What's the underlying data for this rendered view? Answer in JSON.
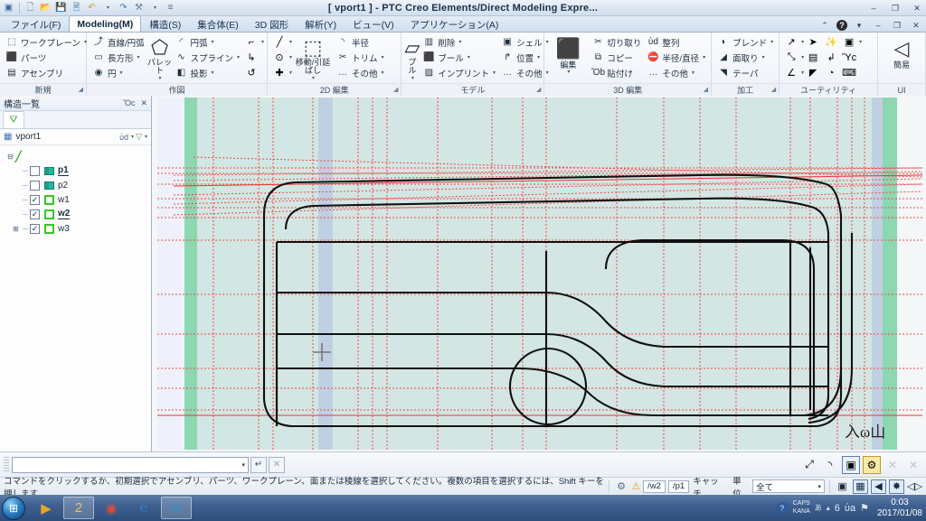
{
  "window": {
    "title": "[ vport1 ] - PTC Creo Elements/Direct Modeling Expre...",
    "minimize": "–",
    "maximize": "❐",
    "close": "✕",
    "inner_minimize": "–",
    "inner_maximize": "❐",
    "inner_close": "✕",
    "help": "?",
    "help_caret": "▾",
    "up_caret": "⌃"
  },
  "quick_access": [
    {
      "name": "app-menu-icon",
      "glyph": "▦"
    },
    {
      "name": "new-icon",
      "glyph": "὜b"
    },
    {
      "name": "open-icon",
      "glyph": "Ὄ2"
    },
    {
      "name": "save-icon",
      "glyph": "Ὃe"
    },
    {
      "name": "print-preview-icon",
      "glyph": "Ὓ6"
    },
    {
      "name": "undo-icon",
      "glyph": "↶"
    },
    {
      "name": "undo-caret",
      "glyph": "▾"
    },
    {
      "name": "redo-icon",
      "glyph": "↷"
    },
    {
      "name": "customize-icon",
      "glyph": "⚒"
    },
    {
      "name": "customize-caret",
      "glyph": "▾"
    },
    {
      "name": "overflow-icon",
      "glyph": "≡"
    }
  ],
  "tabs": [
    {
      "label": "ファイル(F)",
      "active": false
    },
    {
      "label": "Modeling(M)",
      "active": true
    },
    {
      "label": "構造(S)",
      "active": false
    },
    {
      "label": "集合体(E)",
      "active": false
    },
    {
      "label": "3D 図形",
      "active": false
    },
    {
      "label": "解析(Y)",
      "active": false
    },
    {
      "label": "ビュー(V)",
      "active": false
    },
    {
      "label": "アプリケーション(A)",
      "active": false
    }
  ],
  "ribbon": {
    "groups": [
      {
        "label": "新規",
        "launcher": true,
        "items": [
          {
            "icon": "⬚",
            "label": "ワークプレーン",
            "caret": true
          },
          {
            "icon": "⬛",
            "label": "パーツ",
            "caret": false
          },
          {
            "icon": "▤",
            "label": "アセンブリ",
            "caret": false
          }
        ]
      },
      {
        "label": "作図",
        "launcher": false,
        "col1": [
          {
            "icon": "⤴",
            "label": "直線/円弧",
            "caret": false
          },
          {
            "icon": "▭",
            "label": "長方形",
            "caret": true
          },
          {
            "icon": "◉",
            "label": "円",
            "caret": true
          }
        ],
        "big": {
          "icon": "⬠",
          "label": "パレット",
          "caret": true
        },
        "col2": [
          {
            "icon": "◜",
            "label": "円弧",
            "caret": true
          },
          {
            "icon": "∿",
            "label": "スプライン",
            "caret": true
          },
          {
            "icon": "◧",
            "label": "投影",
            "caret": true
          }
        ],
        "col3": [
          {
            "icon": "⌐",
            "caret": true
          },
          {
            "icon": "↳",
            "caret": false
          },
          {
            "icon": "↺",
            "caret": false
          }
        ]
      },
      {
        "label": "2D 編集",
        "launcher": true,
        "col0": [
          {
            "icon": "╱",
            "caret": true
          },
          {
            "icon": "⊙",
            "caret": true
          },
          {
            "icon": "✚",
            "caret": true
          }
        ],
        "big": {
          "icon": "⬚",
          "label": "移動/引延ばし",
          "caret": true
        },
        "col2": [
          {
            "icon": "◝",
            "label": "半径",
            "caret": false
          },
          {
            "icon": "✂",
            "label": "トリム",
            "caret": true
          },
          {
            "icon": "…",
            "label": "その他",
            "caret": true
          }
        ]
      },
      {
        "label": "モデル",
        "launcher": true,
        "big": {
          "icon": "▱",
          "label": "プル",
          "caret": true
        },
        "col2": [
          {
            "icon": "▥",
            "label": "削除",
            "caret": true
          },
          {
            "icon": "⬛",
            "label": "ブール",
            "caret": true
          },
          {
            "icon": "▨",
            "label": "インプリント",
            "caret": true
          }
        ],
        "col3": [
          {
            "icon": "▣",
            "label": "シェル",
            "caret": true
          },
          {
            "icon": "↱",
            "label": "位置",
            "caret": true
          },
          {
            "icon": "…",
            "label": "その他",
            "caret": true
          }
        ]
      },
      {
        "label": "3D 編集",
        "launcher": true,
        "big": {
          "icon": "⬛",
          "label": "編集",
          "caret": true
        },
        "col2": [
          {
            "icon": "✂",
            "label": "切り取り",
            "caret": false
          },
          {
            "icon": "⧉",
            "label": "コピー",
            "caret": false
          },
          {
            "icon": "Ὄb",
            "label": "貼付け",
            "caret": false
          }
        ],
        "col3": [
          {
            "icon": "ὐd",
            "label": "整列",
            "caret": false
          },
          {
            "icon": "⛔",
            "label": "半径/直径",
            "caret": true
          },
          {
            "icon": "…",
            "label": "その他",
            "caret": true
          }
        ]
      },
      {
        "label": "加工",
        "launcher": true,
        "col1": [
          {
            "icon": "◗",
            "label": "ブレンド",
            "caret": true
          },
          {
            "icon": "◢",
            "label": "面取り",
            "caret": true
          },
          {
            "icon": "◥",
            "label": "テーパ",
            "caret": false
          }
        ]
      },
      {
        "label": "ユーティリティ",
        "launcher": false,
        "grid": [
          [
            {
              "icon": "↗",
              "caret": true
            },
            {
              "icon": "➤",
              "caret": false
            },
            {
              "icon": "✨",
              "caret": false
            },
            {
              "icon": "▣",
              "caret": true
            }
          ],
          [
            {
              "icon": "⤡",
              "caret": true
            },
            {
              "icon": "▤",
              "caret": false
            },
            {
              "icon": "↲",
              "caret": false
            },
            {
              "icon": "Ὓc",
              "caret": false
            }
          ],
          [
            {
              "icon": "∠",
              "caret": true
            },
            {
              "icon": "◤",
              "caret": false
            },
            {
              "icon": "◔",
              "caret": false
            },
            {
              "icon": "⌨",
              "caret": false
            }
          ]
        ]
      },
      {
        "label": "UI",
        "launcher": false,
        "big": {
          "icon": "◁",
          "label": "簡易",
          "caret": false
        }
      }
    ]
  },
  "left_panel": {
    "title": "構造一覧",
    "pin": "Ὄc",
    "close": "✕",
    "tab_icon": "⛛",
    "viewport": "vport1",
    "viewport_icon": "▦",
    "find_icon": "ὐd",
    "find_caret": "▾",
    "filter_icon": "▽",
    "filter_caret": "▾",
    "root_icon": "╱",
    "root_expander": "−",
    "tree": [
      {
        "name": "p1",
        "checked": false,
        "icon": "part",
        "bold": true,
        "underline": true,
        "expander": ""
      },
      {
        "name": "p2",
        "checked": false,
        "icon": "part",
        "bold": false,
        "underline": false,
        "expander": ""
      },
      {
        "name": "w1",
        "checked": true,
        "icon": "workplane",
        "bold": false,
        "underline": false,
        "expander": ""
      },
      {
        "name": "w2",
        "checked": true,
        "icon": "workplane",
        "bold": true,
        "underline": true,
        "expander": ""
      },
      {
        "name": "w3",
        "checked": true,
        "icon": "workplane",
        "bold": false,
        "underline": false,
        "expander": "+"
      }
    ]
  },
  "canvas": {
    "background": "#d8e8e4",
    "workplane_fill": "#d5e7e3",
    "construction_color": "#ee4444",
    "geometry_color": "#111111",
    "band_green": "#7fd4a8",
    "band_blue": "#c2cfe4",
    "cursor_glyph": "+",
    "signature": "⼊ω山"
  },
  "command_bar": {
    "input_value": "",
    "input_placeholder": "",
    "dropdown_caret": "▾",
    "enter_label": "↵",
    "cancel_label": "✕",
    "right_icons": [
      {
        "name": "zoom-fit-icon",
        "glyph": "⤢",
        "style": "plain"
      },
      {
        "name": "arc-tool-icon",
        "glyph": "◝",
        "style": "plain"
      },
      {
        "name": "workplane-icon",
        "glyph": "▣",
        "style": "framed"
      },
      {
        "name": "settings-icon",
        "glyph": "⚙",
        "style": "gold"
      },
      {
        "name": "close-x1-icon",
        "glyph": "✕",
        "style": "plain"
      },
      {
        "name": "close-x2-icon",
        "glyph": "✕",
        "style": "plain"
      }
    ]
  },
  "status_bar": {
    "message": "コマンドをクリックするか、初期選択でアセンブリ、パーツ、ワークプレーン、面または稜線を選択してください。複数の項目を選択するには、Shift キーを押します",
    "tool_icon": "⚙",
    "warning_icon": "⚠",
    "workplane": "/w2",
    "part": "/p1",
    "catch_label": "キャッチ",
    "unit_label": "単位",
    "filter_value": "全て",
    "filter_caret": "▾",
    "right_icons": [
      {
        "name": "view-box-icon",
        "glyph": "▣",
        "framed": false
      },
      {
        "name": "render-icon",
        "glyph": "▦",
        "framed": true
      },
      {
        "name": "prev-view-icon",
        "glyph": "◀",
        "framed": true
      },
      {
        "name": "shade-icon",
        "glyph": "✸",
        "framed": true
      },
      {
        "name": "split-view-icon",
        "glyph": "◁▷",
        "framed": false
      }
    ]
  },
  "taskbar": {
    "start_glyph": "⊞",
    "items": [
      {
        "name": "media-player",
        "glyph": "▶",
        "pinned": false
      },
      {
        "name": "file-explorer",
        "glyph": "὜2",
        "pinned": true
      },
      {
        "name": "google-chrome",
        "glyph": "◉",
        "pinned": false
      },
      {
        "name": "internet-explorer",
        "glyph": "℮",
        "pinned": false
      },
      {
        "name": "creo-elements",
        "glyph": "⚙",
        "pinned": true
      }
    ],
    "tray": {
      "action_center": "?",
      "ime_line1": "CAPS",
      "ime_line2": "KANA",
      "ime_icon": "あ",
      "ime_caret": "▾",
      "show_hidden": "▴",
      "network": "὏6",
      "volume": "ὐa",
      "flag": "⚑",
      "time": "0:03",
      "date": "2017/01/08"
    }
  }
}
